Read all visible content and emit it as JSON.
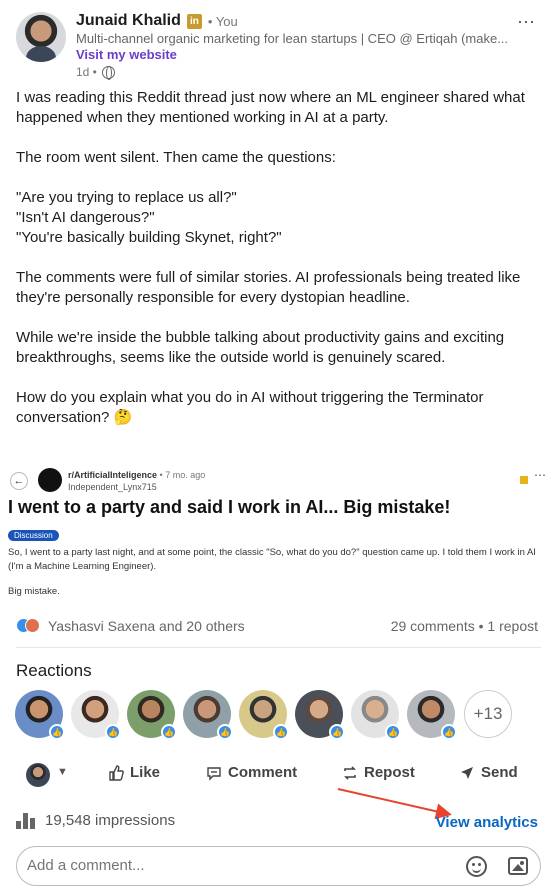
{
  "author": {
    "name": "Junaid Khalid",
    "badge": "in",
    "relation": "• You",
    "headline": "Multi-channel organic marketing for lean startups | CEO @ Ertiqah (make...",
    "website_link": "Visit my website",
    "time": "1d •"
  },
  "post": {
    "paragraphs": [
      "I was reading this Reddit thread just now where an ML engineer shared what happened when they mentioned working in AI at a party.\n\n",
      "The room went silent. Then came the questions:",
      "\"Are you trying to replace us all?\"\n\"Isn't AI dangerous?\"\n\"You're basically building Skynet, right?\"",
      "The comments were full of similar stories. AI professionals being treated like they're personally responsible for every dystopian headline.",
      "While we're inside the bubble talking about productivity gains and exciting breakthroughs, seems like the outside world is genuinely scared.",
      "How do you explain what you do in AI without triggering the Terminator conversation? 🤔"
    ]
  },
  "reddit_card": {
    "subreddit": "r/ArtificialInteligence",
    "time": "• 7 mo. ago",
    "username": "Independent_Lynx715",
    "title": "I went to a party and said I work in AI... Big mistake!",
    "flair": "Discussion",
    "body": "So, I went to a party last night, and at some point, the classic \"So, what do you do?\" question came up. I told them I work in AI (I'm a Machine Learning Engineer).",
    "body2": "Big mistake."
  },
  "social": {
    "reactions_text": "Yashasvi Saxena and 20 others",
    "comments_reposts": "29 comments • 1 repost"
  },
  "reactions": {
    "title": "Reactions",
    "more": "+13"
  },
  "actions": {
    "like": "Like",
    "comment": "Comment",
    "repost": "Repost",
    "send": "Send"
  },
  "analytics": {
    "impressions": "19,548 impressions",
    "view_analytics": "View analytics"
  },
  "comment_box": {
    "placeholder": "Add a comment..."
  },
  "colors": {
    "link_purple": "#6a3fc7",
    "link_blue": "#0a66c2",
    "like_blue": "#378fe9",
    "arrow_red": "#e8432c"
  }
}
